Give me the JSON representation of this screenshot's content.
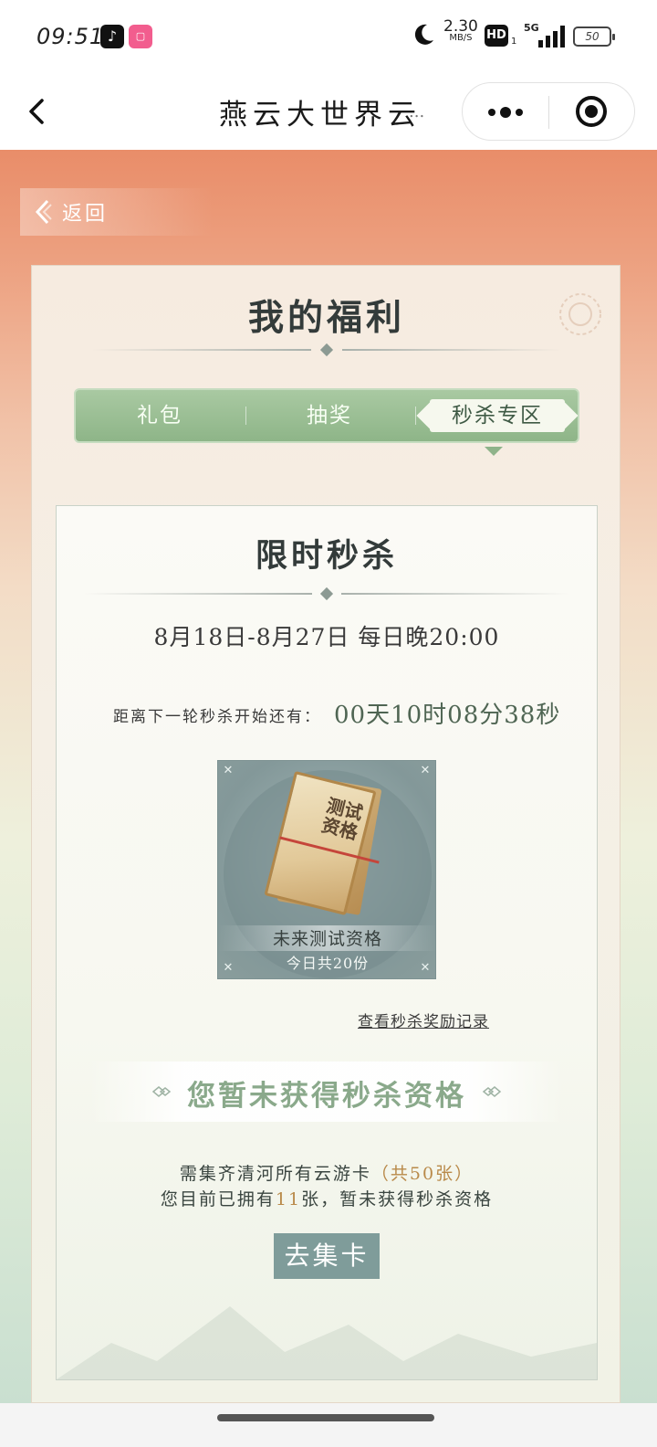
{
  "status_bar": {
    "time": "09:51",
    "speed_value": "2.30",
    "speed_unit": "MB/S",
    "hd_label": "HD",
    "hd_sub": "1",
    "network": "5G",
    "battery": "50"
  },
  "nav": {
    "title": "燕云大世界云",
    "title_ellipsis": "..."
  },
  "page": {
    "back_label": "返回",
    "title": "我的福利",
    "tabs": [
      {
        "label": "礼包"
      },
      {
        "label": "抽奖"
      },
      {
        "label": "秒杀专区"
      }
    ],
    "active_tab": "秒杀专区"
  },
  "flash_sale": {
    "title": "限时秒杀",
    "date_range": "8月18日-8月27日  每日晚20:00",
    "countdown_label": "距离下一轮秒杀开始还有：",
    "countdown_value": "00天10时08分38秒",
    "prize": {
      "card_text": "测试资格",
      "name": "未来测试资格",
      "count": "今日共20份"
    },
    "record_link": "查看秒杀奖励记录",
    "status": "您暂未获得秒杀资格",
    "requirement_prefix": "需集齐清河所有云游卡",
    "requirement_highlight": "（共50张）",
    "owned_prefix": "您目前已拥有",
    "owned_count": "11",
    "owned_suffix": "张，暂未获得秒杀资格",
    "button_label": "去集卡"
  },
  "colors": {
    "accent_green": "#8eb588",
    "button": "#7f9c9a",
    "highlight": "#b98a4a"
  }
}
